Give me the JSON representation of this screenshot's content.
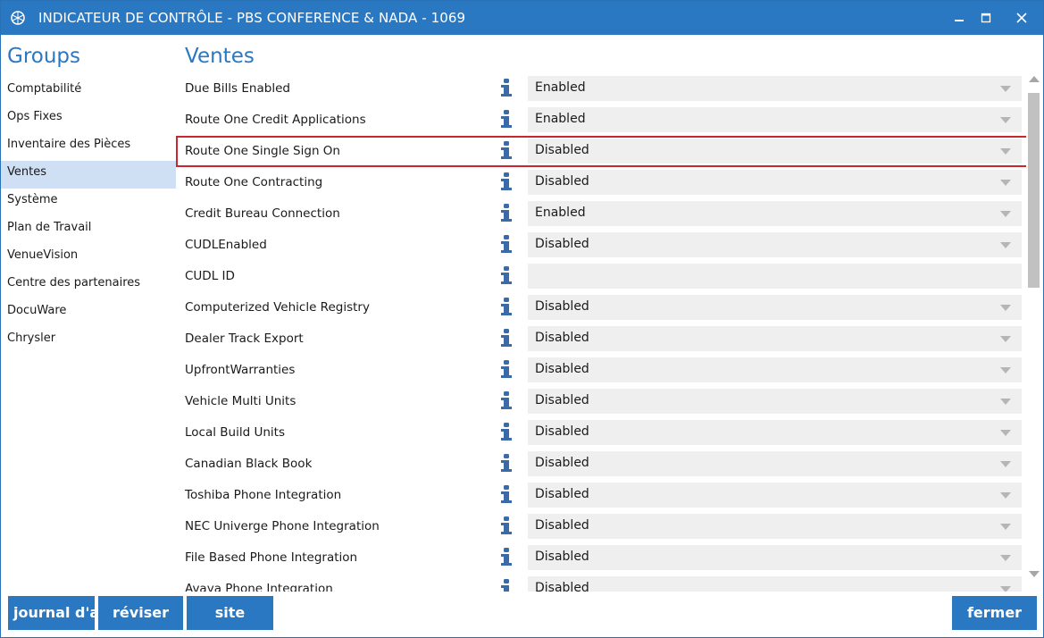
{
  "window": {
    "title": "INDICATEUR DE CONTRÔLE - PBS CONFERENCE & NADA - 1069",
    "app_icon": "pbs-logo-icon",
    "controls": [
      "minimize-icon",
      "maximize-icon",
      "close-icon"
    ]
  },
  "groups": {
    "heading": "Groups",
    "items": [
      {
        "label": "Comptabilité"
      },
      {
        "label": "Ops Fixes"
      },
      {
        "label": "Inventaire des Pièces"
      },
      {
        "label": "Ventes"
      },
      {
        "label": "Système"
      },
      {
        "label": "Plan de Travail"
      },
      {
        "label": "VenueVision"
      },
      {
        "label": "Centre des partenaires"
      },
      {
        "label": "DocuWare"
      },
      {
        "label": "Chrysler"
      }
    ],
    "selected": "Ventes"
  },
  "main": {
    "heading": "Ventes",
    "settings": [
      {
        "label": "Due Bills Enabled",
        "value": "Enabled"
      },
      {
        "label": "Route One Credit Applications",
        "value": "Enabled"
      },
      {
        "label": "Route One Single Sign On",
        "value": "Disabled"
      },
      {
        "label": "Route One Contracting",
        "value": "Disabled"
      },
      {
        "label": "Credit Bureau Connection",
        "value": "Enabled"
      },
      {
        "label": "CUDLEnabled",
        "value": "Disabled"
      },
      {
        "label": "CUDL ID",
        "value": ""
      },
      {
        "label": "Computerized Vehicle Registry",
        "value": "Disabled"
      },
      {
        "label": "Dealer Track Export",
        "value": "Disabled"
      },
      {
        "label": "UpfrontWarranties",
        "value": "Disabled"
      },
      {
        "label": "Vehicle Multi Units",
        "value": "Disabled"
      },
      {
        "label": "Local Build Units",
        "value": "Disabled"
      },
      {
        "label": "Canadian Black Book",
        "value": "Disabled"
      },
      {
        "label": "Toshiba Phone Integration",
        "value": "Disabled"
      },
      {
        "label": "NEC Univerge Phone Integration",
        "value": "Disabled"
      },
      {
        "label": "File Based Phone Integration",
        "value": "Disabled"
      },
      {
        "label": "Avaya Phone Integration",
        "value": "Disabled"
      }
    ],
    "highlighted_setting": "Route One Single Sign On"
  },
  "buttons": {
    "journal": "journal d'audit",
    "reviser": "réviser",
    "site": "site",
    "fermer": "fermer"
  },
  "colors": {
    "accent": "#2b78c2",
    "selected_group": "#cfe0f4",
    "highlight_border": "#c8272e",
    "select_bg": "#efefef"
  }
}
